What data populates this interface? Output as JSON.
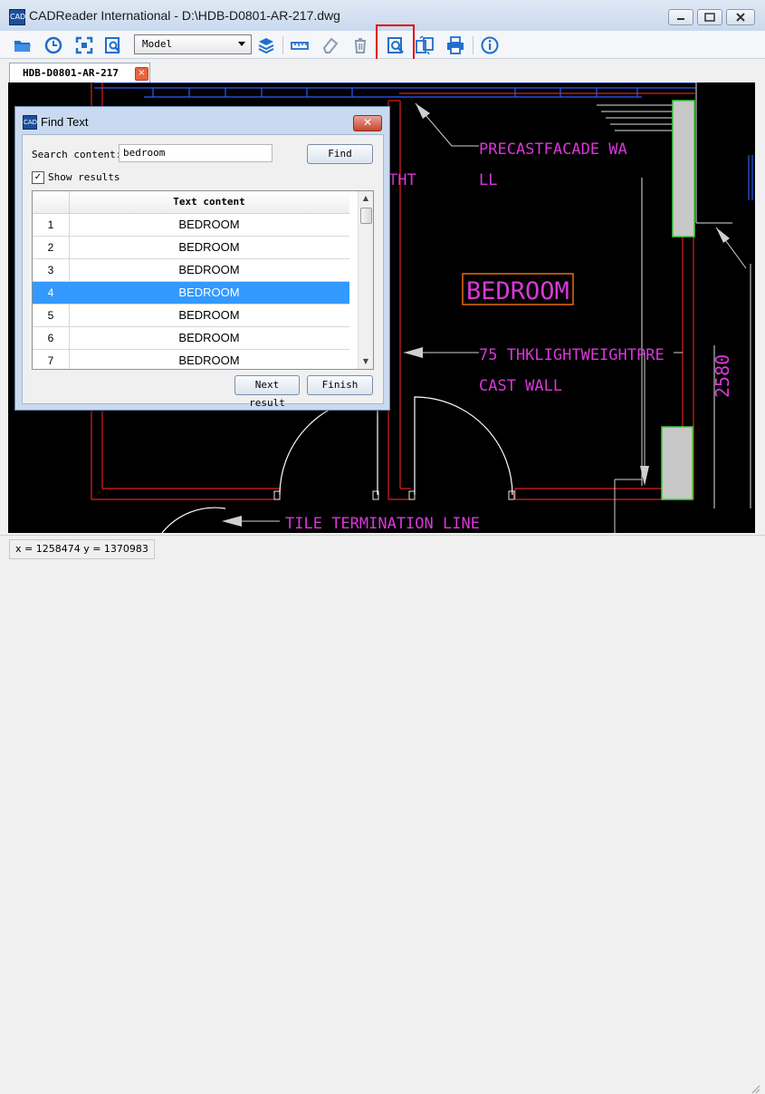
{
  "window": {
    "title": "CADReader International - D:\\HDB-D0801-AR-217.dwg",
    "app_icon_text": "CAD"
  },
  "toolbar": {
    "layout_value": "Model",
    "icons": [
      "open-folder-icon",
      "history-icon",
      "zoom-extents-icon",
      "zoom-window-icon",
      "layers-icon",
      "measure-icon",
      "eraser-icon",
      "trash-icon",
      "find-text-icon",
      "export-icon",
      "print-icon",
      "info-icon"
    ]
  },
  "tab": {
    "label": "HDB-D0801-AR-217"
  },
  "drawing": {
    "labels": {
      "precast_1": "PRECASTFACADE WA",
      "precast_2": "LL",
      "tht": "THT",
      "bedroom": "BEDROOM",
      "wall_1": "75 THKLIGHTWEIGHTPRE",
      "wall_2": "CAST WALL",
      "dimension": "2580",
      "tile": "TILE TERMINATION LINE"
    },
    "colors": {
      "background": "#000000",
      "text": "#d838d8",
      "walls": "#e02020",
      "highlight": "#e86a10",
      "blue": "#2a5cff",
      "green": "#40d040"
    }
  },
  "dialog": {
    "title": "Find Text",
    "search_label": "Search content:",
    "search_value": "bedroom",
    "find_label": "Find",
    "show_results_label": "Show results",
    "show_results_checked": true,
    "column_header": "Text content",
    "rows": [
      {
        "num": "1",
        "text": "BEDROOM"
      },
      {
        "num": "2",
        "text": "BEDROOM"
      },
      {
        "num": "3",
        "text": "BEDROOM"
      },
      {
        "num": "4",
        "text": "BEDROOM"
      },
      {
        "num": "5",
        "text": "BEDROOM"
      },
      {
        "num": "6",
        "text": "BEDROOM"
      },
      {
        "num": "7",
        "text": "BEDROOM"
      }
    ],
    "selected_row": "4",
    "next_label": "Next result",
    "finish_label": "Finish"
  },
  "status": {
    "coords": "x = 1258474 y = 1370983"
  }
}
